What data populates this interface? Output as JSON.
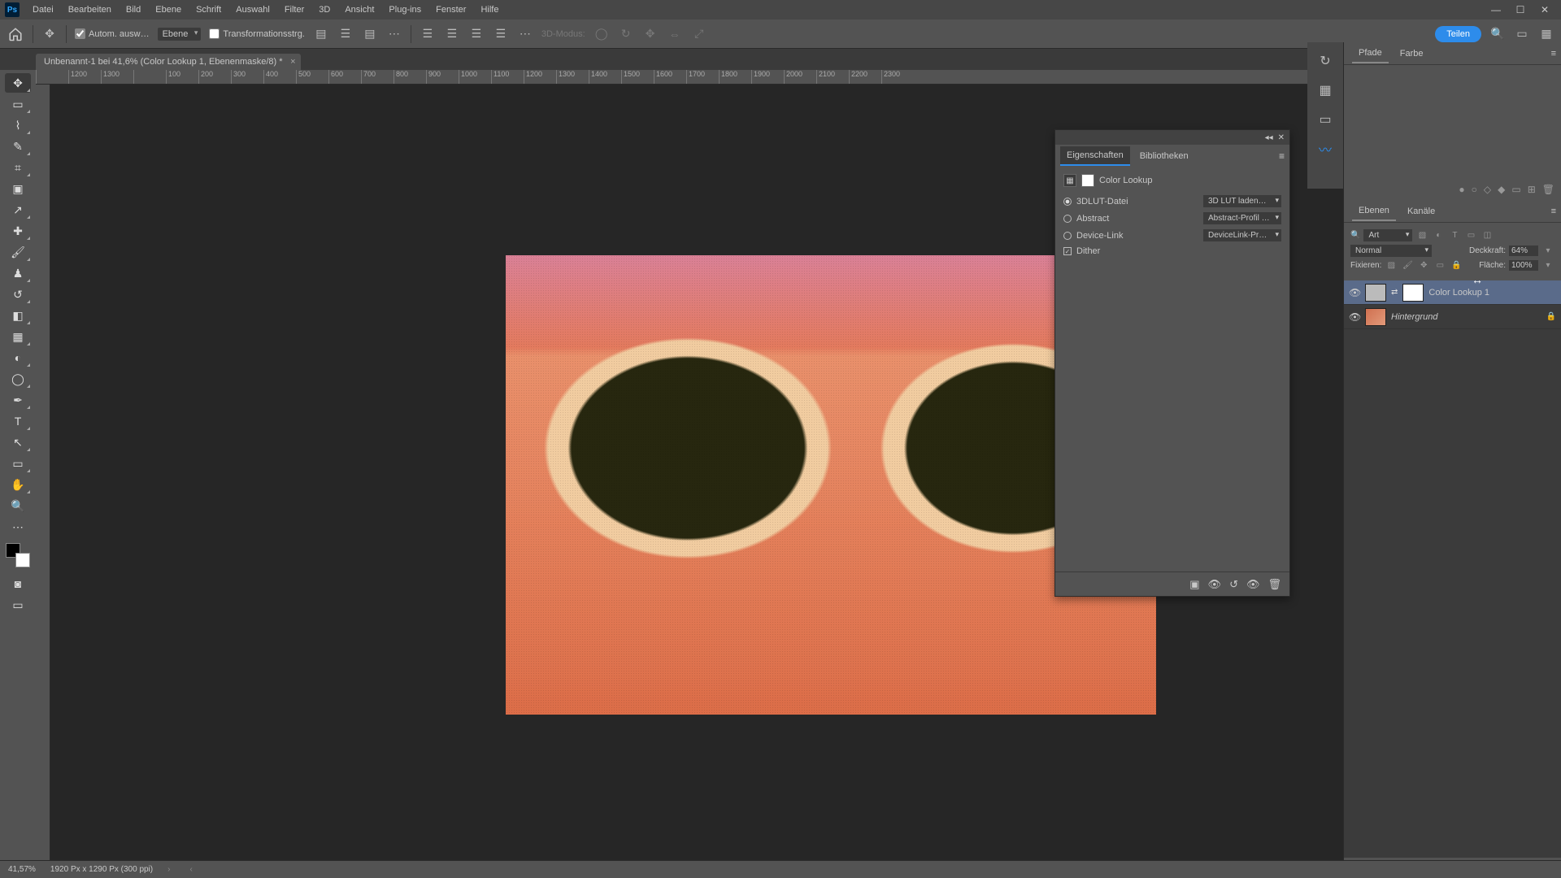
{
  "menu": {
    "items": [
      "Datei",
      "Bearbeiten",
      "Bild",
      "Ebene",
      "Schrift",
      "Auswahl",
      "Filter",
      "3D",
      "Ansicht",
      "Plug-ins",
      "Fenster",
      "Hilfe"
    ]
  },
  "options": {
    "auto_select_label": "Autom. ausw…",
    "layer_dropdown": "Ebene",
    "transform_controls_label": "Transformationsstrg.",
    "mode3d_label": "3D-Modus:",
    "share_label": "Teilen"
  },
  "document": {
    "tab_title": "Unbenannt-1 bei 41,6% (Color Lookup 1, Ebenenmaske/8) *"
  },
  "ruler_ticks": [
    "",
    "1200",
    "1300",
    "",
    "100",
    "200",
    "300",
    "400",
    "500",
    "600",
    "700",
    "800",
    "900",
    "1000",
    "1100",
    "1200",
    "1300",
    "1400",
    "1500",
    "1600",
    "1700",
    "1800",
    "1900",
    "2000",
    "2100",
    "2200",
    "2300"
  ],
  "properties_panel": {
    "tabs": [
      "Eigenschaften",
      "Bibliotheken"
    ],
    "title": "Color Lookup",
    "rows": {
      "r1_label": "3DLUT-Datei",
      "r1_value": "3D LUT laden…",
      "r2_label": "Abstract",
      "r2_value": "Abstract-Profil la…",
      "r3_label": "Device-Link",
      "r3_value": "DeviceLink-Profil…",
      "dither_label": "Dither"
    }
  },
  "right_dock": {
    "tabs_top": [
      "Pfade",
      "Farbe"
    ],
    "tabs_layers": [
      "Ebenen",
      "Kanäle"
    ],
    "filter_label": "Art",
    "blend_mode": "Normal",
    "opacity_label": "Deckkraft:",
    "opacity_value": "64%",
    "lock_label": "Fixieren:",
    "fill_label": "Fläche:",
    "fill_value": "100%",
    "layers": [
      {
        "name": "Color Lookup 1"
      },
      {
        "name": "Hintergrund"
      }
    ]
  },
  "status": {
    "zoom": "41,57%",
    "doc_info": "1920 Px x 1290 Px (300 ppi)"
  }
}
